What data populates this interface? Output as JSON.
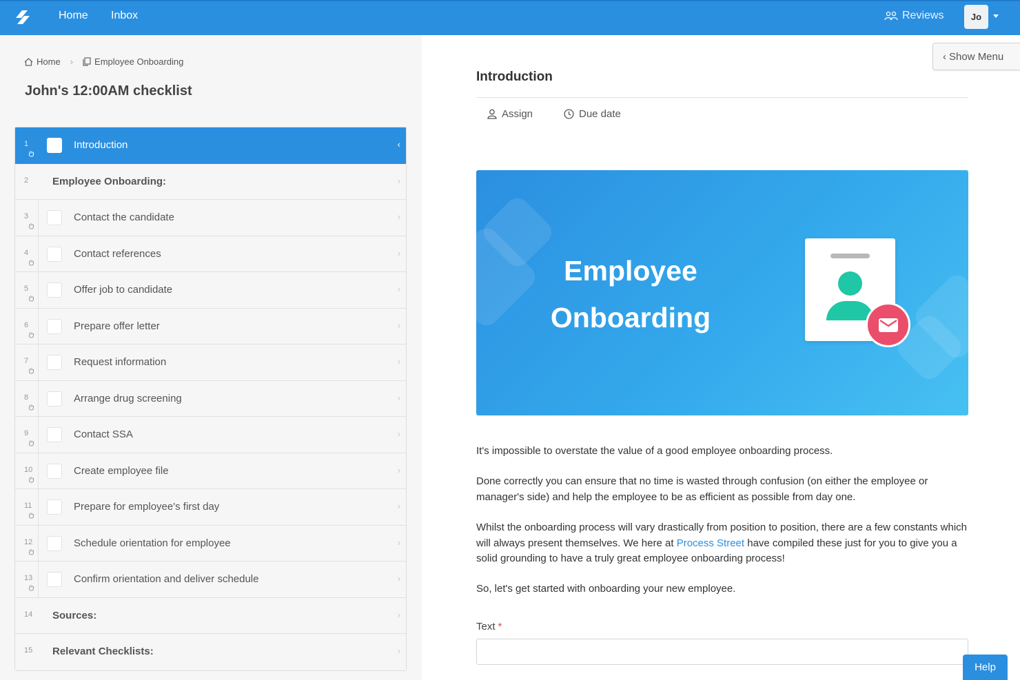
{
  "topbar": {
    "logo_icon": "process-street-logo-icon",
    "nav": [
      {
        "label": "Home"
      },
      {
        "label": "Inbox"
      }
    ],
    "reviews_label": "Reviews",
    "reviews_icon": "people-icon",
    "user_initials": "Jo"
  },
  "breadcrumb": {
    "home_label": "Home",
    "current_label": "Employee Onboarding"
  },
  "checklist": {
    "title": "John's 12:00AM checklist"
  },
  "tasks": [
    {
      "num": "1",
      "label": "Introduction",
      "type": "task",
      "active": true
    },
    {
      "num": "2",
      "label": "Employee Onboarding:",
      "type": "heading"
    },
    {
      "num": "3",
      "label": "Contact the candidate",
      "type": "task"
    },
    {
      "num": "4",
      "label": "Contact references",
      "type": "task"
    },
    {
      "num": "5",
      "label": "Offer job to candidate",
      "type": "task"
    },
    {
      "num": "6",
      "label": "Prepare offer letter",
      "type": "task"
    },
    {
      "num": "7",
      "label": "Request information",
      "type": "task"
    },
    {
      "num": "8",
      "label": "Arrange drug screening",
      "type": "task"
    },
    {
      "num": "9",
      "label": "Contact SSA",
      "type": "task"
    },
    {
      "num": "10",
      "label": "Create employee file",
      "type": "task"
    },
    {
      "num": "11",
      "label": "Prepare for employee's first day",
      "type": "task"
    },
    {
      "num": "12",
      "label": "Schedule orientation for employee",
      "type": "task"
    },
    {
      "num": "13",
      "label": "Confirm orientation and deliver schedule",
      "type": "task"
    },
    {
      "num": "14",
      "label": "Sources:",
      "type": "heading"
    },
    {
      "num": "15",
      "label": "Relevant Checklists:",
      "type": "heading"
    }
  ],
  "main": {
    "show_menu_label": "Show Menu",
    "task_title": "Introduction",
    "assign_label": "Assign",
    "due_date_label": "Due date",
    "banner": {
      "line1": "Employee",
      "line2": "Onboarding",
      "accent_blue": "#2b8fe0",
      "accent_teal": "#1fc7a6",
      "accent_red": "#ea4e6b"
    },
    "paragraphs": {
      "p1": "It's impossible to overstate the value of a good employee onboarding process.",
      "p2": "Done correctly you can ensure that no time is wasted through confusion (on either the employee or manager's side) and help the employee to be as efficient as possible from day one.",
      "p3_before": "Whilst the onboarding process will vary drastically from position to position, there are a few constants which will always present themselves. We here at ",
      "p3_link": "Process Street",
      "p3_after": " have compiled these just for you to give you a solid grounding to have a truly great employee onboarding process!",
      "p4": "So, let's get started with onboarding your new employee."
    },
    "field": {
      "label": "Text",
      "required_mark": "*",
      "value": ""
    },
    "help_label": "Help"
  }
}
